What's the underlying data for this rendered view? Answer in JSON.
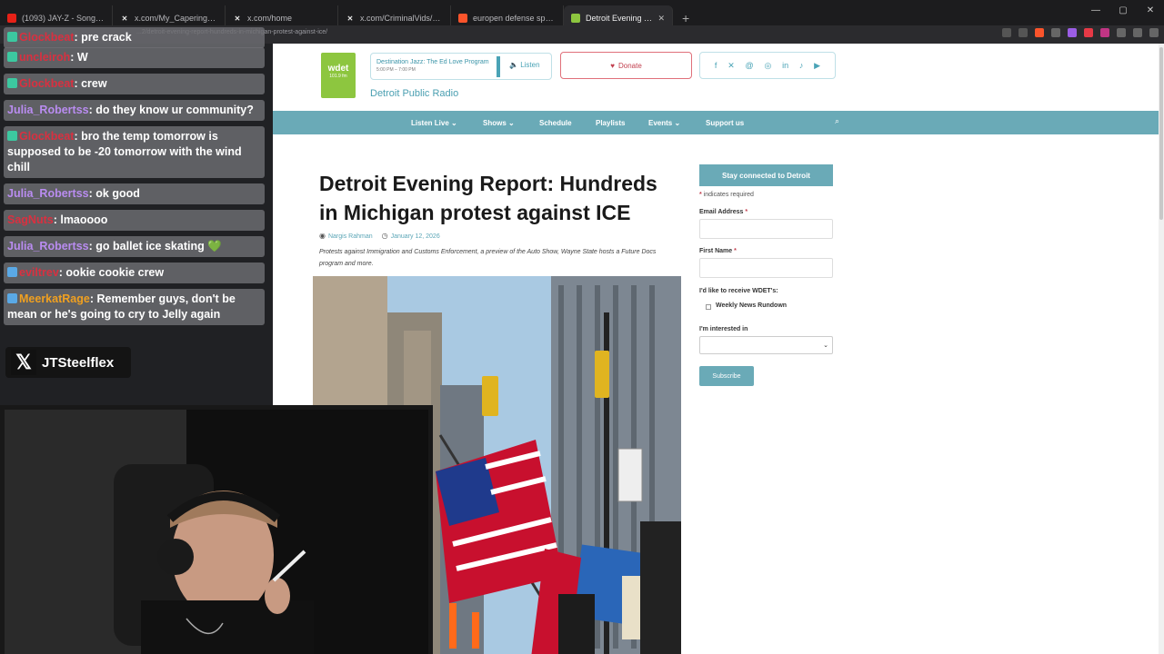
{
  "browser": {
    "tabs": [
      {
        "title": "(1093) JAY-Z - Song Cry - YouTube",
        "icon": "youtube-icon",
        "color": "#e62117"
      },
      {
        "title": "x.com/My_Capering_ld/status/20123",
        "icon": "x-icon",
        "color": "#e8e8e8"
      },
      {
        "title": "x.com/home",
        "icon": "x-icon",
        "color": "#e8e8e8"
      },
      {
        "title": "x.com/CriminalVids/status/20123153",
        "icon": "x-icon",
        "color": "#e8e8e8"
      },
      {
        "title": "europen defense spending - Brave Se",
        "icon": "brave-icon",
        "color": "#fb542b"
      },
      {
        "title": "Detroit Evening Report: Hundred",
        "icon": "wdet-icon",
        "color": "#8dc63f"
      }
    ],
    "address": "...2/detroit-evening-report-hundreds-in-michigan-protest-against-ice/"
  },
  "site": {
    "station": "Detroit Public Radio",
    "logo": "wdet",
    "logo_sub": "101.9 fm",
    "player": {
      "show": "Destination Jazz: The Ed Love Program",
      "time": "5:00 PM – 7:00 PM",
      "listen": "Listen"
    },
    "donate": "Donate",
    "social": [
      "facebook-icon",
      "x-icon",
      "threads-icon",
      "instagram-icon",
      "linkedin-icon",
      "tiktok-icon",
      "youtube-icon"
    ],
    "nav": [
      "Listen Live ⌄",
      "Shows ⌄",
      "Schedule",
      "Playlists",
      "Events ⌄",
      "Support us"
    ]
  },
  "article": {
    "headline": "Detroit Evening Report: Hundreds in Michigan protest against ICE",
    "author": "Nargis Rahman",
    "date": "January 12, 2026",
    "dek": "Protests against Immigration and Customs Enforcement, a preview of the Auto Show, Wayne State hosts a Future Docs program and more."
  },
  "signup": {
    "title": "Stay connected to Detroit",
    "required": "indicates required",
    "email_label": "Email Address",
    "first_label": "First Name",
    "receive_label": "I'd like to receive WDET's:",
    "newsletter": "Weekly News Rundown",
    "interest_label": "I'm interested in",
    "subscribe": "Subscribe"
  },
  "chat": [
    {
      "user": "Glockbeat",
      "color": "#d93040",
      "text": "pre crack",
      "badge": "#3cc8a0"
    },
    {
      "user": "uncleiroh",
      "color": "#d93040",
      "text": "W",
      "badge": "#3cc8a0"
    },
    {
      "user": "Glockbeat",
      "color": "#d93040",
      "text": "crew",
      "badge": "#3cc8a0"
    },
    {
      "user": "Julia_Robertss",
      "color": "#b98cf0",
      "text": "do they know ur community?",
      "badge": ""
    },
    {
      "user": "Glockbeat",
      "color": "#d93040",
      "text": "bro the temp tomorrow is supposed to be -20 tomorrow with the wind chill",
      "badge": "#3cc8a0"
    },
    {
      "user": "Julia_Robertss",
      "color": "#b98cf0",
      "text": "ok good",
      "badge": ""
    },
    {
      "user": "SagNuts",
      "color": "#d93040",
      "text": "lmaoooo",
      "badge": ""
    },
    {
      "user": "Julia_Robertss",
      "color": "#b98cf0",
      "text": "go ballet ice skating 💚",
      "badge": ""
    },
    {
      "user": "eviltrev",
      "color": "#d93040",
      "text": "ookie cookie crew",
      "badge": "#5aa9e6"
    },
    {
      "user": "MeerkatRage",
      "color": "#f0a020",
      "text": "Remember guys, don't be mean or he's going to cry to Jelly again",
      "badge": "#5aa9e6"
    }
  ],
  "overlay": {
    "handle": "JTSteelflex",
    "handle_icon": "x-logo-icon"
  }
}
